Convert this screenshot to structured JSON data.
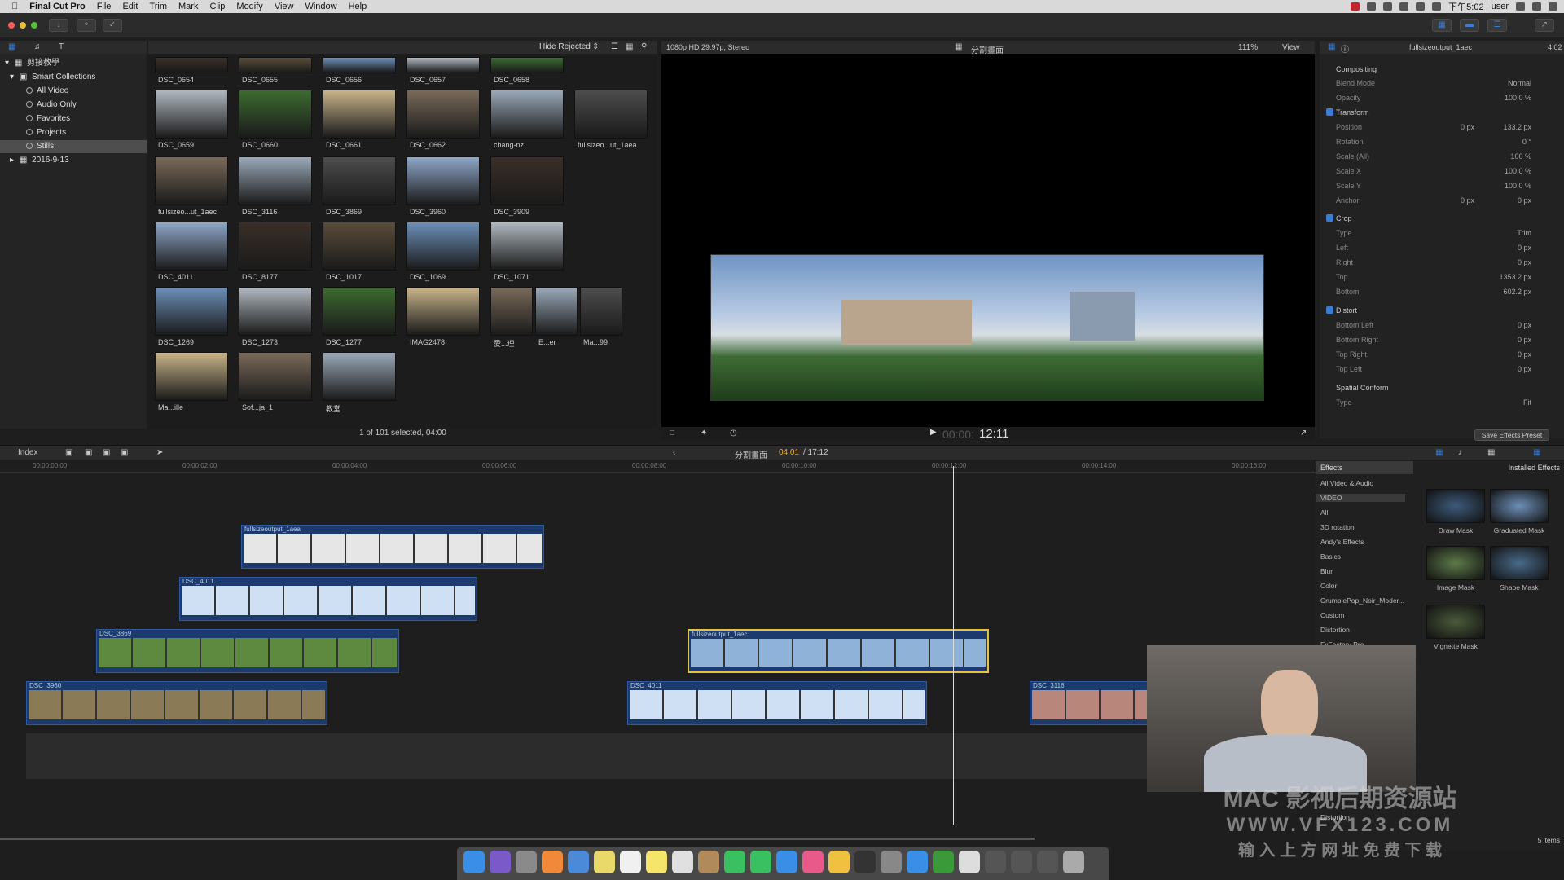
{
  "menubar": {
    "app_name": "Final Cut Pro",
    "items": [
      "File",
      "Edit",
      "Trim",
      "Mark",
      "Clip",
      "Modify",
      "View",
      "Window",
      "Help"
    ],
    "time": "下午5:02",
    "user": "user"
  },
  "library": {
    "name": "剪接教學",
    "smart_collections": "Smart Collections",
    "items": [
      "All Video",
      "Audio Only",
      "Favorites",
      "Projects",
      "Stills"
    ],
    "selected": "Stills",
    "event": "2016-9-13"
  },
  "browser": {
    "filter": "Hide Rejected",
    "status": "1 of 101 selected, 04:00",
    "rows": [
      [
        "DSC_0654",
        "DSC_0655",
        "DSC_0656",
        "DSC_0657",
        "DSC_0658"
      ],
      [
        "DSC_0659",
        "DSC_0660",
        "DSC_0661",
        "DSC_0662",
        "chang-nz",
        "fullsizeo...ut_1aea"
      ],
      [
        "fullsizeo...ut_1aec",
        "DSC_3116",
        "DSC_3869",
        "DSC_3960",
        "DSC_3909"
      ],
      [
        "DSC_4011",
        "DSC_8177",
        "DSC_1017",
        "DSC_1069",
        "DSC_1071"
      ],
      [
        "DSC_1269",
        "DSC_1273",
        "DSC_1277",
        "IMAG2478",
        "愛...理",
        "E...er",
        "Ma...99"
      ],
      [
        "Ma...ille",
        "Sof...ja_1",
        "教堂"
      ]
    ]
  },
  "viewer": {
    "format": "1080p HD 29.97p, Stereo",
    "title": "分割畫面",
    "zoom": "111%",
    "view_label": "View",
    "timecode_dim": "00:00:",
    "timecode": "12:11"
  },
  "inspector": {
    "clip_name": "fullsizeoutput_1aec",
    "duration": "4:02",
    "compositing": "Compositing",
    "blend_mode_label": "Blend Mode",
    "blend_mode": "Normal",
    "opacity_label": "Opacity",
    "opacity": "100.0 %",
    "transform": "Transform",
    "position_label": "Position",
    "position_x": "0 px",
    "position_y": "133.2 px",
    "rotation_label": "Rotation",
    "rotation": "0 °",
    "scale_all_label": "Scale (All)",
    "scale_all": "100 %",
    "scale_x_label": "Scale X",
    "scale_x": "100.0 %",
    "scale_y_label": "Scale Y",
    "scale_y": "100.0 %",
    "anchor_label": "Anchor",
    "anchor_x": "0 px",
    "anchor_y": "0 px",
    "crop": "Crop",
    "type_label": "Type",
    "crop_type": "Trim",
    "left_label": "Left",
    "left": "0 px",
    "right_label": "Right",
    "right": "0 px",
    "top_label": "Top",
    "top": "1353.2 px",
    "bottom_label": "Bottom",
    "bottom": "602.2 px",
    "distort": "Distort",
    "bl_label": "Bottom Left",
    "br_label": "Bottom Right",
    "tr_label": "Top Right",
    "tl_label": "Top Left",
    "zero_px": "0 px",
    "spatial_conform": "Spatial Conform",
    "conform_type": "Fit",
    "save_preset": "Save Effects Preset",
    "x": "X",
    "y": "Y"
  },
  "timeline": {
    "index": "Index",
    "project": "分割畫面",
    "position": "04:01",
    "duration": "/ 17:12",
    "ticks": [
      "00:00:00:00",
      "00:00:02:00",
      "00:00:04:00",
      "00:00:06:00",
      "00:00:08:00",
      "00:00:10:00",
      "00:00:12:00",
      "00:00:14:00",
      "00:00:16:00"
    ],
    "clips": [
      {
        "name": "fullsizeoutput_1aea"
      },
      {
        "name": "DSC_4011"
      },
      {
        "name": "DSC_3869"
      },
      {
        "name": "fullsizeoutput_1aec"
      },
      {
        "name": "DSC_3960"
      },
      {
        "name": "DSC_4011"
      },
      {
        "name": "DSC_3116"
      }
    ]
  },
  "effects": {
    "header": "Effects",
    "installed": "Installed Effects",
    "categories": [
      "All Video & Audio",
      "VIDEO",
      "All",
      "3D rotation",
      "Andy's Effects",
      "Basics",
      "Blur",
      "Color",
      "CrumplePop_Noir_Moder...",
      "Custom",
      "Distortion",
      "FxFactory Pro"
    ],
    "items": [
      "Draw Mask",
      "Graduated Mask",
      "Image Mask",
      "Shape Mask",
      "Vignette Mask"
    ],
    "count": "5 items",
    "bottom_cat": "Distortion"
  },
  "watermark": {
    "line1": "MAC 影视后期资源站",
    "line2": "WWW.VFX123.COM",
    "line3": "输 入 上 方 网 址   免 费 下 载"
  }
}
